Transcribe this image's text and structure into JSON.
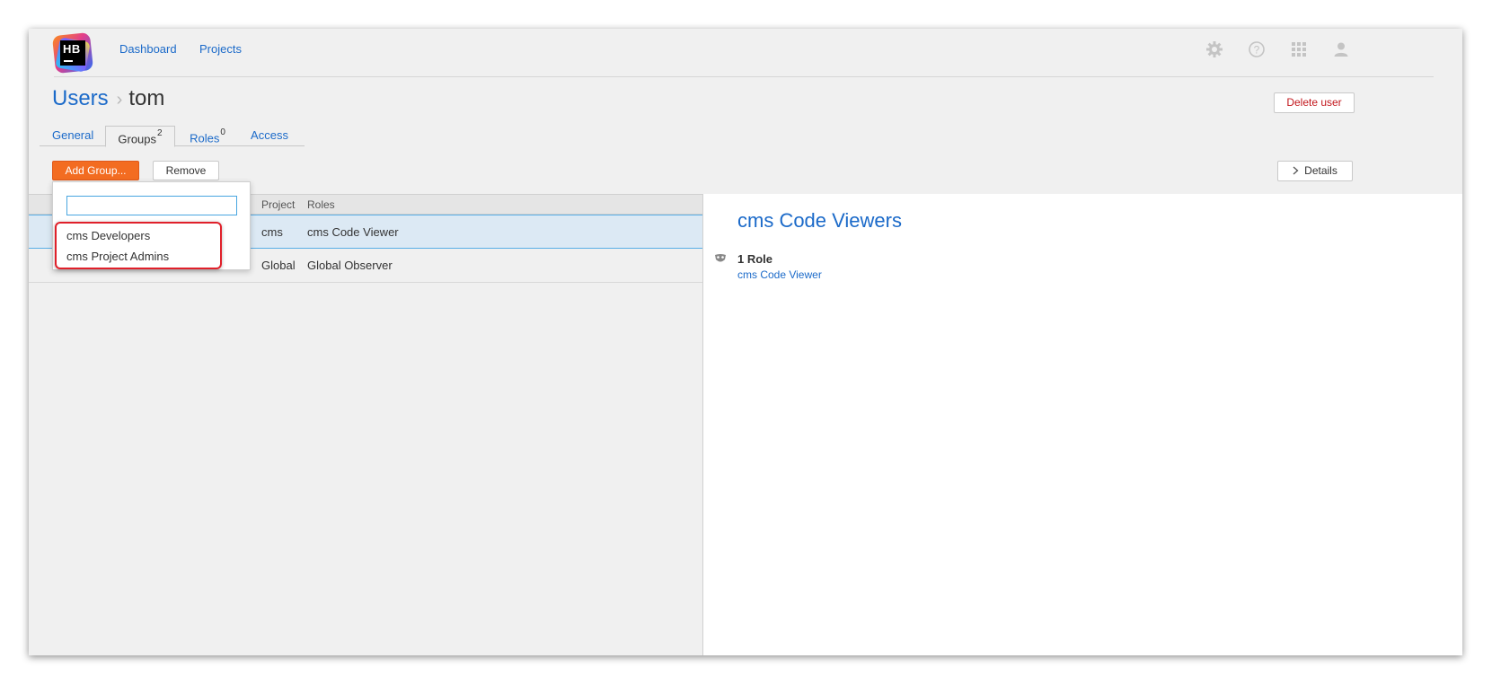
{
  "header": {
    "logo_text": "HB",
    "nav": {
      "dashboard": "Dashboard",
      "projects": "Projects"
    },
    "icons": [
      "gear-icon",
      "help-icon",
      "apps-grid-icon",
      "user-icon"
    ]
  },
  "breadcrumb": {
    "parent": "Users",
    "separator": "›",
    "current": "tom"
  },
  "actions": {
    "delete_user": "Delete user",
    "add_group": "Add Group...",
    "remove": "Remove",
    "details": "Details"
  },
  "tabs": [
    {
      "label": "General",
      "count": ""
    },
    {
      "label": "Groups",
      "count": "2"
    },
    {
      "label": "Roles",
      "count": "0"
    },
    {
      "label": "Access",
      "count": ""
    }
  ],
  "table": {
    "columns": [
      "Project",
      "Roles"
    ],
    "rows": [
      {
        "project": "cms",
        "roles": "cms Code Viewer"
      },
      {
        "project": "Global",
        "roles": "Global Observer"
      }
    ]
  },
  "popup": {
    "search_value": "",
    "items": [
      "cms Developers",
      "cms Project Admins"
    ]
  },
  "detail": {
    "title": "cms Code Viewers",
    "roles_count": "1 Role",
    "roles": [
      "cms Code Viewer"
    ]
  },
  "colors": {
    "accent": "#f36c21",
    "link": "#1b6ac9",
    "danger": "#c2171d",
    "highlight": "#e0202a"
  }
}
